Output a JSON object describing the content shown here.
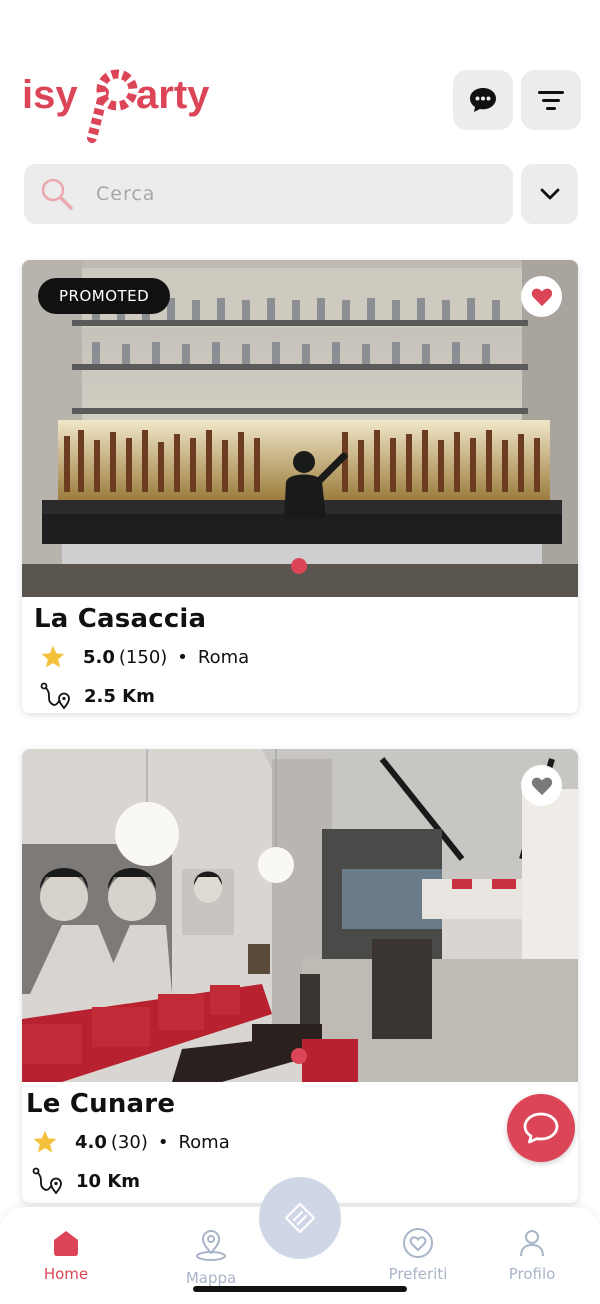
{
  "app": {
    "logo_text": "isyParty",
    "accent_color": "#dc4557"
  },
  "header": {
    "chat_icon": "chat-bubble-icon",
    "filter_icon": "filter-lines-icon"
  },
  "search": {
    "placeholder": "Cerca",
    "value": "",
    "dropdown_icon": "chevron-down-icon"
  },
  "venues": [
    {
      "name": "La Casaccia",
      "badge": "PROMOTED",
      "rating": "5.0",
      "reviews": "(150)",
      "separator": "•",
      "city": "Roma",
      "distance": "2.5 Km",
      "favorite": true
    },
    {
      "name": "Le Cunare",
      "badge": "",
      "rating": "4.0",
      "reviews": "(30)",
      "separator": "•",
      "city": "Roma",
      "distance": "10 Km",
      "favorite": false
    }
  ],
  "tabs": [
    {
      "label": "Home",
      "icon": "home-icon",
      "active": true
    },
    {
      "label": "Mappa",
      "icon": "map-pin-icon",
      "active": false
    },
    {
      "label": "",
      "icon": "ticket-icon",
      "active": false
    },
    {
      "label": "Preferiti",
      "icon": "heart-icon",
      "active": false
    },
    {
      "label": "Profilo",
      "icon": "user-icon",
      "active": false
    }
  ]
}
